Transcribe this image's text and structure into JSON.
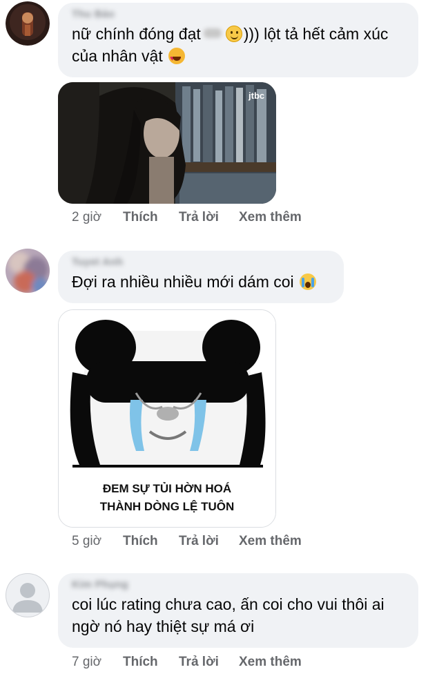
{
  "comments": [
    {
      "author": "Thu Bảo",
      "text_parts": [
        "nữ chính đóng đạt",
        "))) lột tả hết cảm xúc của nhân vật"
      ],
      "media_watermark": "jtbc",
      "time": "2 giờ",
      "actions": [
        "Thích",
        "Trả lời",
        "Xem thêm"
      ]
    },
    {
      "author": "Tuyet Anh",
      "text": "Đợi ra nhiều nhiều mới dám coi",
      "meme_caption_line1": "ĐEM SỰ TỦI HỜN HOÁ",
      "meme_caption_line2": "THÀNH DÒNG LỆ TUÔN",
      "time": "5 giờ",
      "actions": [
        "Thích",
        "Trả lời",
        "Xem thêm"
      ]
    },
    {
      "author": "Kim Phụng",
      "text": "coi lúc rating chưa cao, ấn coi cho vui thôi ai ngờ nó hay thiệt sự má ơi",
      "time": "7 giờ",
      "actions": [
        "Thích",
        "Trả lời",
        "Xem thêm"
      ]
    }
  ],
  "icons": {
    "emoji_1": "slightly-smiling-face-icon",
    "emoji_2": "heart-eyes-face-icon",
    "emoji_3": "crying-face-icon",
    "default_avatar": "default-user-avatar-icon"
  },
  "colors": {
    "bubble": "#f0f2f5",
    "meta_text": "#65676b"
  }
}
